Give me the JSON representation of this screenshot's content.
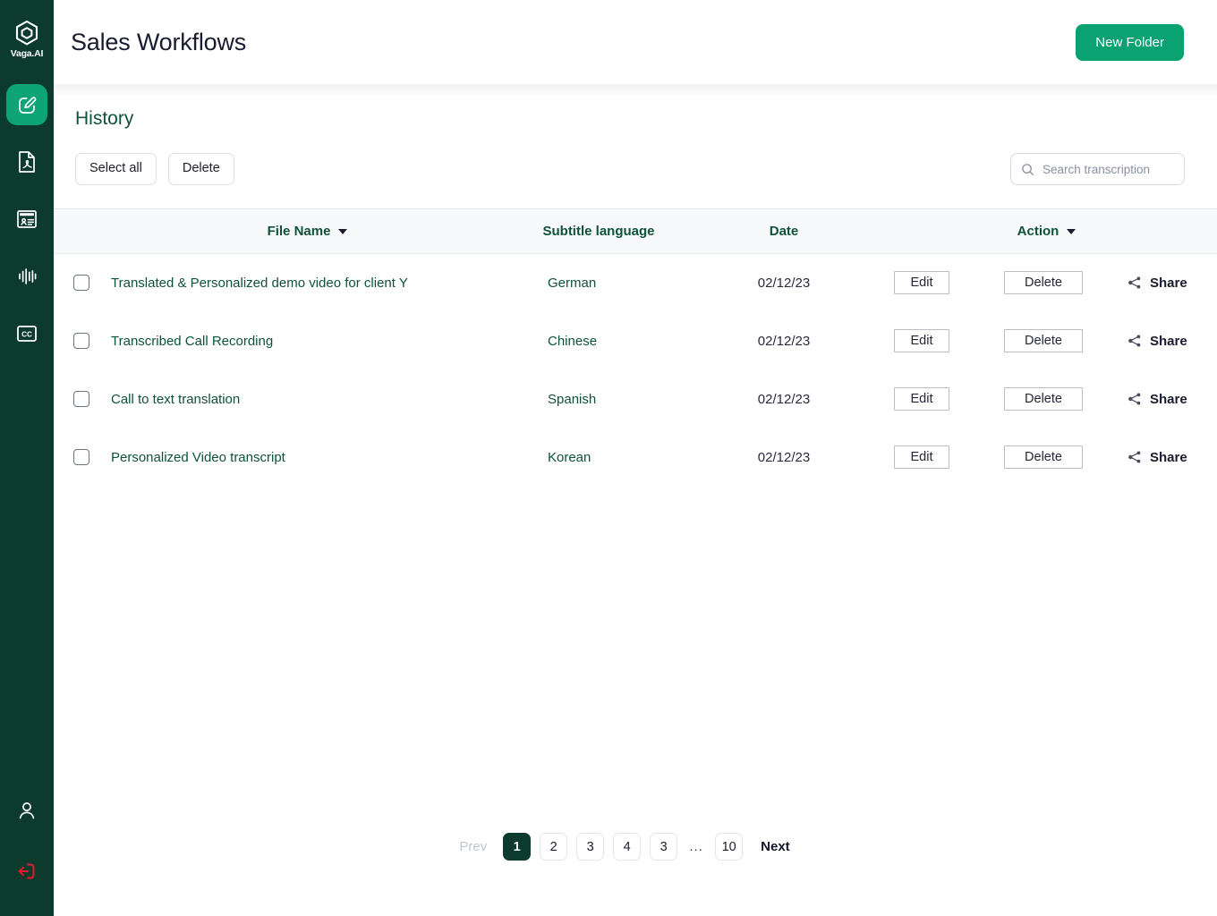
{
  "sidebar": {
    "logo": {
      "name": "Vaga.AI",
      "icon": "hexagon-logo-icon"
    },
    "items": [
      {
        "label": "Edit",
        "icon": "edit-square-icon",
        "active": true
      },
      {
        "label": "PDF",
        "icon": "pdf-file-icon",
        "active": false
      },
      {
        "label": "Card",
        "icon": "id-card-icon",
        "active": false
      },
      {
        "label": "Audio",
        "icon": "audio-waveform-icon",
        "active": false
      },
      {
        "label": "Captions",
        "icon": "closed-caption-icon",
        "active": false
      }
    ],
    "bottom_items": [
      {
        "label": "Profile",
        "icon": "user-profile-icon"
      },
      {
        "label": "Log out",
        "icon": "logout-icon"
      }
    ]
  },
  "header": {
    "title": "Sales Workflows",
    "new_folder_label": "New Folder"
  },
  "content": {
    "section_title": "History",
    "select_all_label": "Select all",
    "delete_label": "Delete",
    "search": {
      "placeholder": "Search transcription",
      "value": "",
      "icon": "search-icon"
    }
  },
  "table": {
    "columns": [
      {
        "key": "checkbox",
        "label": ""
      },
      {
        "key": "file_name",
        "label": "File Name",
        "sortable": true
      },
      {
        "key": "subtitle_language",
        "label": "Subtitle language",
        "sortable": false
      },
      {
        "key": "date",
        "label": "Date",
        "sortable": false
      },
      {
        "key": "action",
        "label": "Action",
        "sortable": true
      }
    ],
    "action_labels": {
      "edit": "Edit",
      "delete": "Delete",
      "share": "Share",
      "share_icon": "share-nodes-icon"
    },
    "rows": [
      {
        "checked": false,
        "file_name": "Translated & Personalized demo video for client Y",
        "subtitle_language": "German",
        "date": "02/12/23"
      },
      {
        "checked": false,
        "file_name": "Transcribed Call Recording",
        "subtitle_language": "Chinese",
        "date": "02/12/23"
      },
      {
        "checked": false,
        "file_name": "Call to text translation",
        "subtitle_language": "Spanish",
        "date": "02/12/23"
      },
      {
        "checked": false,
        "file_name": "Personalized Video transcript",
        "subtitle_language": "Korean",
        "date": "02/12/23"
      }
    ]
  },
  "pagination": {
    "prev_label": "Prev",
    "next_label": "Next",
    "ellipsis": "...",
    "current_page": "1",
    "pages": [
      "1",
      "2",
      "3",
      "4",
      "3"
    ],
    "last_page": "10"
  },
  "colors": {
    "sidebar_bg": "#0c3b2e",
    "accent_green": "#0ba271",
    "active_nav": "#0fa474",
    "text_green": "#0e5239",
    "text_dark": "#1b1b2f",
    "logout_red": "#e8192c"
  }
}
